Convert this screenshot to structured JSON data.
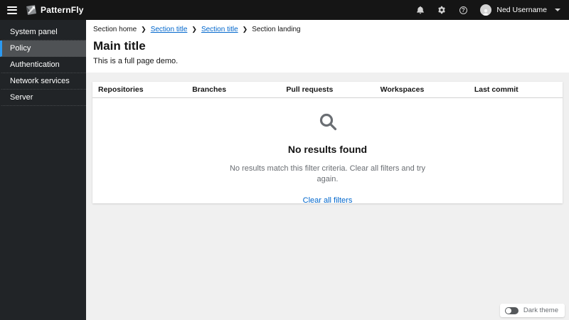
{
  "masthead": {
    "brand": "PatternFly",
    "user": {
      "name": "Ned Username"
    },
    "icons": [
      "bell-icon",
      "cog-icon",
      "help-icon"
    ]
  },
  "sidebar": {
    "items": [
      {
        "label": "System panel",
        "current": false
      },
      {
        "label": "Policy",
        "current": true
      },
      {
        "label": "Authentication",
        "current": false
      },
      {
        "label": "Network services",
        "current": false
      },
      {
        "label": "Server",
        "current": false
      }
    ]
  },
  "breadcrumb": {
    "items": [
      {
        "label": "Section home",
        "link": false
      },
      {
        "label": "Section title",
        "link": true
      },
      {
        "label": "Section title",
        "link": true
      },
      {
        "label": "Section landing",
        "link": false
      }
    ]
  },
  "page": {
    "title": "Main title",
    "subtitle": "This is a full page demo."
  },
  "table": {
    "columns": [
      "Repositories",
      "Branches",
      "Pull requests",
      "Workspaces",
      "Last commit"
    ]
  },
  "empty_state": {
    "icon": "search-icon",
    "title": "No results found",
    "body": "No results match this filter criteria. Clear all filters and try again.",
    "action": "Clear all filters"
  },
  "theme_toggle": {
    "label": "Dark theme",
    "state": "off"
  },
  "colors": {
    "masthead_bg": "#151515",
    "sidebar_bg": "#212427",
    "nav_current_bg": "#4f5255",
    "nav_accent": "#2b9af3",
    "link_blue": "#0066cc",
    "page_bg": "#f0f0f0",
    "muted_text": "#6a6e73",
    "border": "#d2d2d2"
  }
}
